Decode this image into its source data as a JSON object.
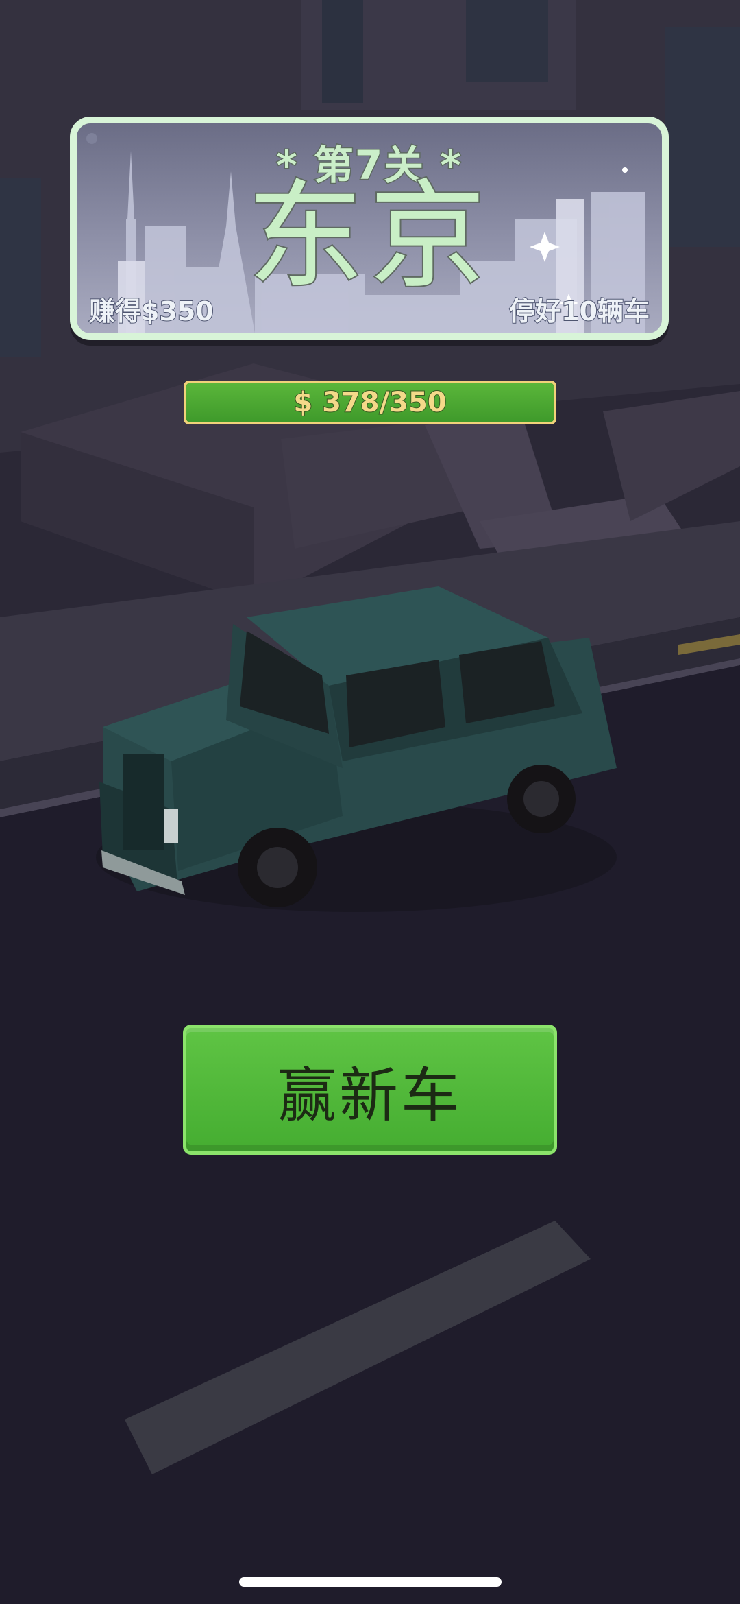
{
  "level": {
    "title": "* 第7关 *",
    "city": "东京",
    "goal_earn": "赚得$350",
    "goal_park": "停好10辆车"
  },
  "progress": {
    "text": "$ 378/350",
    "fraction": 1.0
  },
  "win_button": {
    "label": "赢新车"
  },
  "colors": {
    "accent_green": "#4fb436",
    "banner_text": "#c9efc6",
    "progress_border": "#f1d27a"
  },
  "icons": [
    "sparkle-icon"
  ]
}
